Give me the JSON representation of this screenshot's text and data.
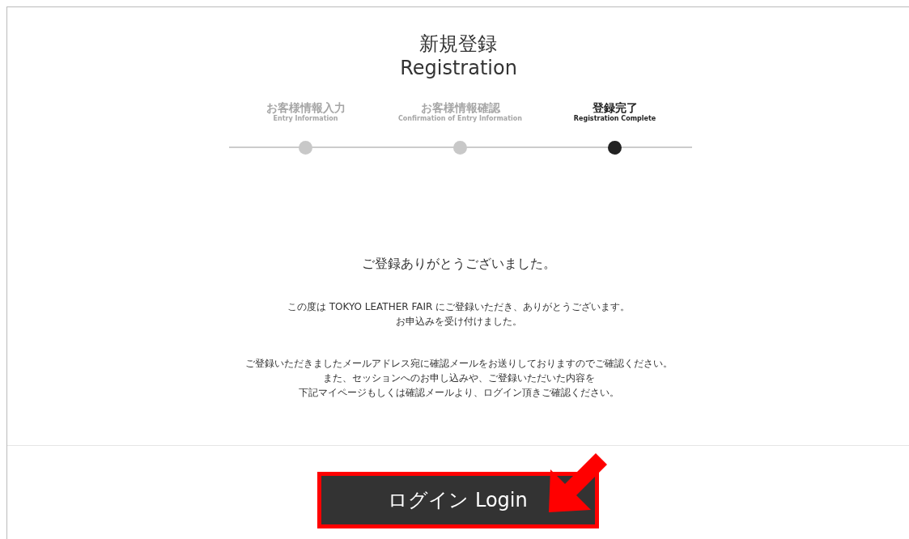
{
  "title": {
    "ja": "新規登録",
    "en": "Registration"
  },
  "steps": [
    {
      "ja": "お客様情報入力",
      "en": "Entry Information",
      "selected": false
    },
    {
      "ja": "お客様情報確認",
      "en": "Confirmation of Entry Information",
      "selected": false
    },
    {
      "ja": "登録完了",
      "en": "Registration Complete",
      "selected": true
    }
  ],
  "heading": "ご登録ありがとうございました。",
  "paragraphs": [
    [
      "この度は TOKYO LEATHER FAIR にご登録いただき、ありがとうございます。",
      "お申込みを受け付けました。"
    ],
    [
      "ご登録いただきましたメールアドレス宛に確認メールをお送りしておりますのでご確認ください。",
      "また、セッションへのお申し込みや、ご登録いただいた内容を",
      "下記マイページもしくは確認メールより、ログイン頂きご確認ください。"
    ]
  ],
  "login_button": {
    "label": "ログイン Login",
    "highlighted": true
  }
}
